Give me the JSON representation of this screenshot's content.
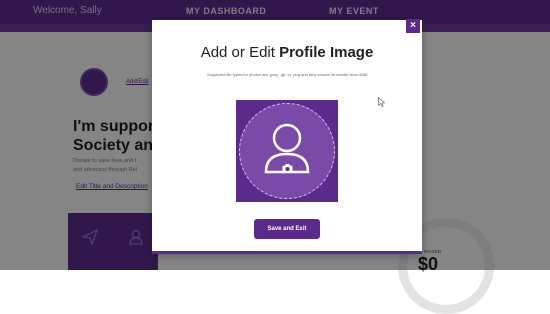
{
  "topnav": {
    "welcome": "Welcome, Sally",
    "items": [
      "MY DASHBOARD",
      "MY EVENT"
    ]
  },
  "background": {
    "add_link": "Add/Edit",
    "headline_line1": "I'm supporti",
    "headline_line2": "Society and",
    "body_line1": "Donate to save lives and f",
    "body_line2": "and advocacy through Rel",
    "edit_link": "Edit Title and Description",
    "raised_label": "RAISED",
    "raised_amount": "$0"
  },
  "modal": {
    "close_label": "×",
    "title_prefix": "Add or Edit ",
    "title_bold": "Profile Image",
    "subtitle": "Supported file types for photos are .jpeg, .gif, or .png and they should be smaller than 4MB",
    "save_label": "Save and Exit"
  },
  "icons": {
    "close": "close-icon",
    "avatar": "user-placeholder-icon",
    "camera": "camera-icon",
    "paper_plane": "paper-plane-icon",
    "user": "user-icon",
    "cursor": "mouse-pointer-icon"
  },
  "colors": {
    "brand_purple": "#5b2a8a",
    "overlay": "rgba(0,0,0,0.45)"
  }
}
